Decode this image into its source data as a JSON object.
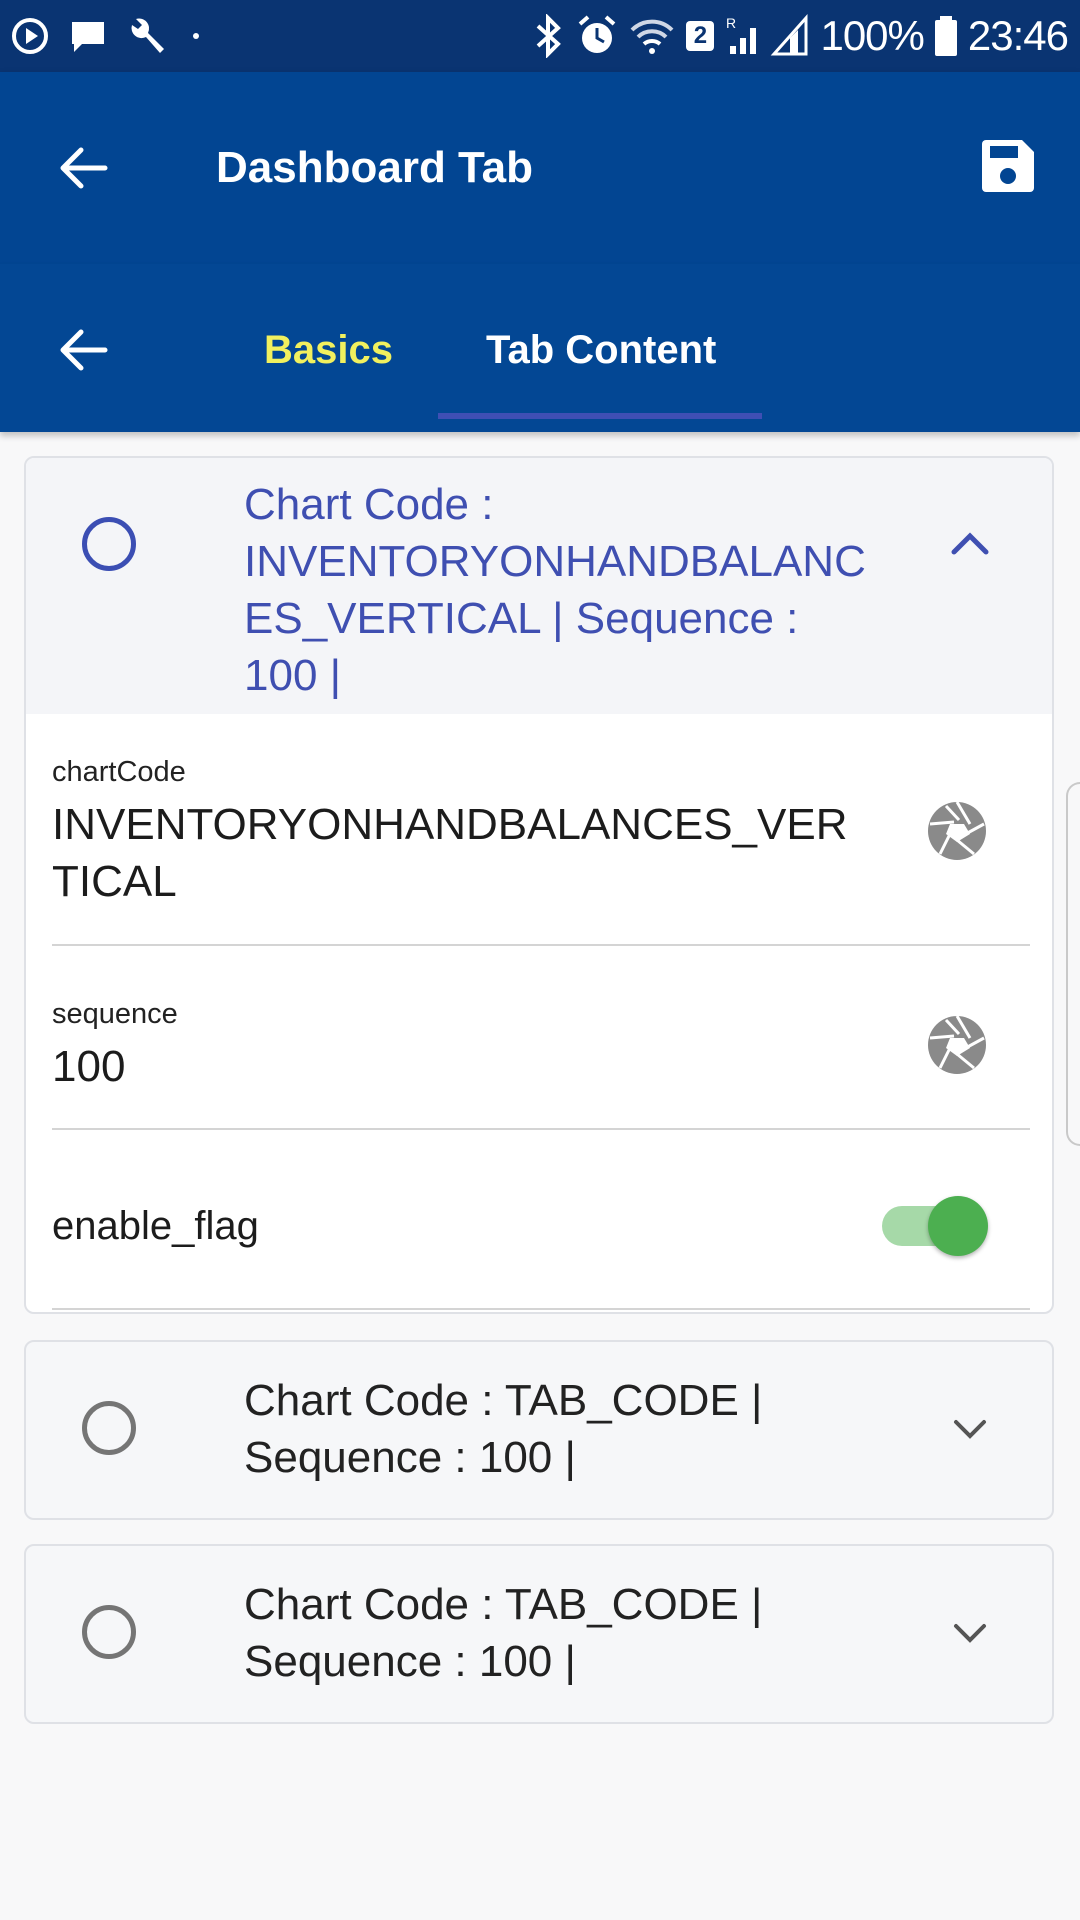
{
  "status_bar": {
    "battery": "100%",
    "time": "23:46",
    "sim_badge": "2",
    "roaming": "R"
  },
  "app_bar": {
    "title": "Dashboard Tab",
    "back_icon": "arrow-left-icon",
    "save_icon": "floppy-disk-icon"
  },
  "tabs": {
    "items": [
      {
        "label": "Basics",
        "active": false
      },
      {
        "label": "Tab Content",
        "active": true
      }
    ]
  },
  "cards": [
    {
      "header": "Chart Code : INVENTORYONHANDBALANCES_VERTICAL | Sequence : 100 |",
      "header_lines": [
        "Chart Code :",
        "INVENTORYONHANDBALANC",
        "ES_VERTICAL | Sequence :",
        "100 |"
      ],
      "expanded": true,
      "fields": [
        {
          "label": "chartCode",
          "value_lines": [
            "INVENTORYONHANDBALANCES_VER",
            "TICAL"
          ],
          "icon": "aperture-icon"
        },
        {
          "label": "sequence",
          "value": "100",
          "icon": "aperture-icon"
        }
      ],
      "toggle": {
        "label": "enable_flag",
        "on": true
      }
    },
    {
      "header_lines": [
        "Chart Code : TAB_CODE |",
        "Sequence : 100 |"
      ],
      "expanded": false
    },
    {
      "header_lines": [
        "Chart Code : TAB_CODE |",
        "Sequence : 100 |"
      ],
      "expanded": false
    }
  ],
  "colors": {
    "status_bar": "#0a3472",
    "app_bar": "#024592",
    "tab_active_indicator": "#3f4fb4",
    "tab_basics_text": "#f1f05e",
    "accent_blue": "#3f4fb1",
    "toggle_on": "#4caf50"
  }
}
